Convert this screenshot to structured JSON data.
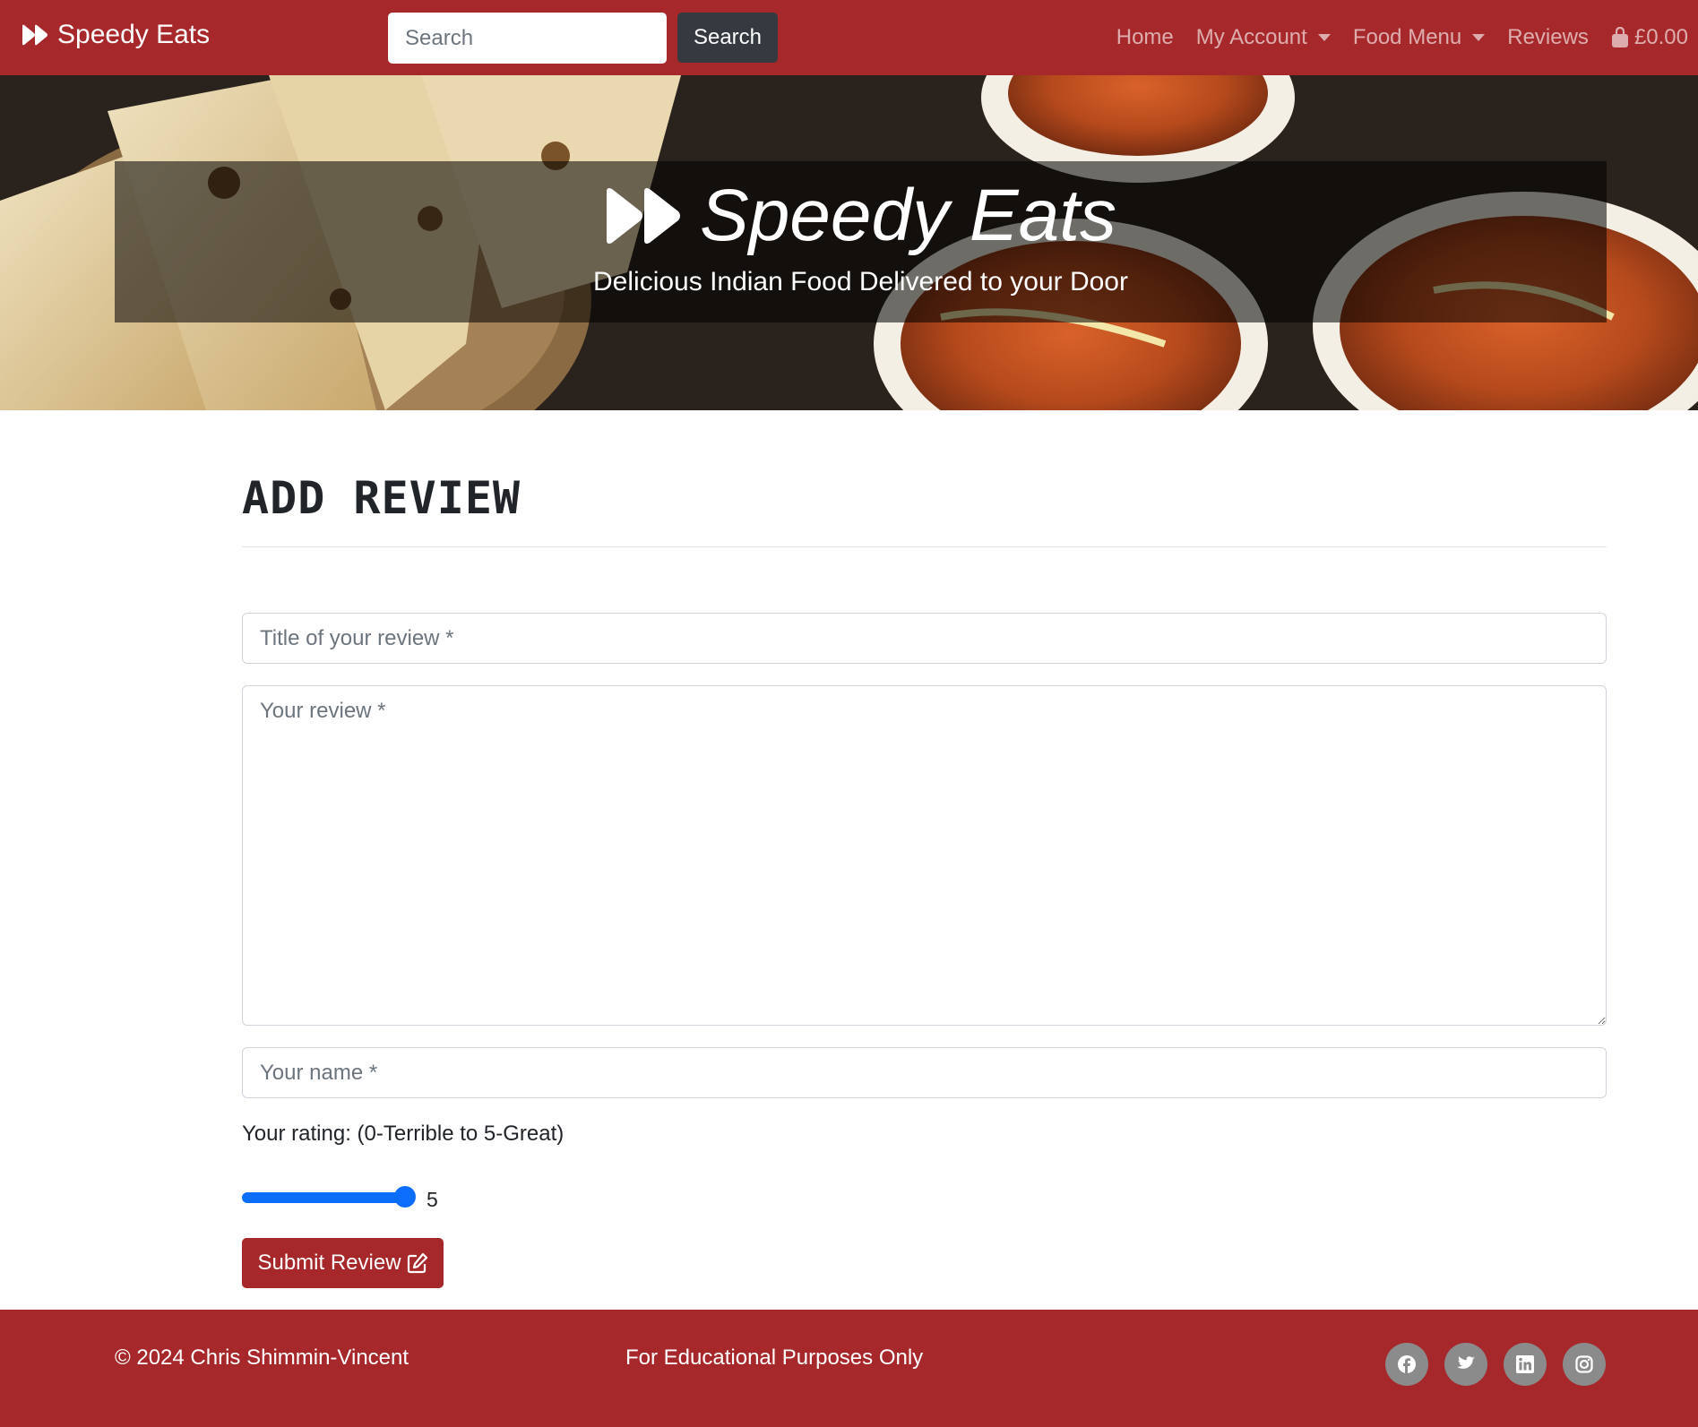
{
  "navbar": {
    "brand": "Speedy Eats",
    "search_placeholder": "Search",
    "search_button": "Search",
    "links": {
      "home": "Home",
      "account": "My Account",
      "menu": "Food Menu",
      "reviews": "Reviews",
      "basket_total": "£0.00"
    }
  },
  "hero": {
    "title": "Speedy Eats",
    "subtitle": "Delicious Indian Food Delivered to your Door"
  },
  "form": {
    "heading": "ADD REVIEW",
    "title_placeholder": "Title of your review *",
    "review_placeholder": "Your review *",
    "name_placeholder": "Your name *",
    "rating_label": "Your rating: (0-Terrible to 5-Great)",
    "rating_value": "5",
    "rating_min": 0,
    "rating_max": 5,
    "submit_label": "Submit Review"
  },
  "footer": {
    "copyright": "© 2024 Chris Shimmin-Vincent",
    "note": "For Educational Purposes Only",
    "social_icons": [
      "facebook-icon",
      "twitter-icon",
      "linkedin-icon",
      "instagram-icon"
    ]
  },
  "colors": {
    "brand_red": "#a6282b",
    "dark_button": "#343a40",
    "slider_blue": "#0d6efd",
    "social_grey": "#8b8b8b"
  }
}
